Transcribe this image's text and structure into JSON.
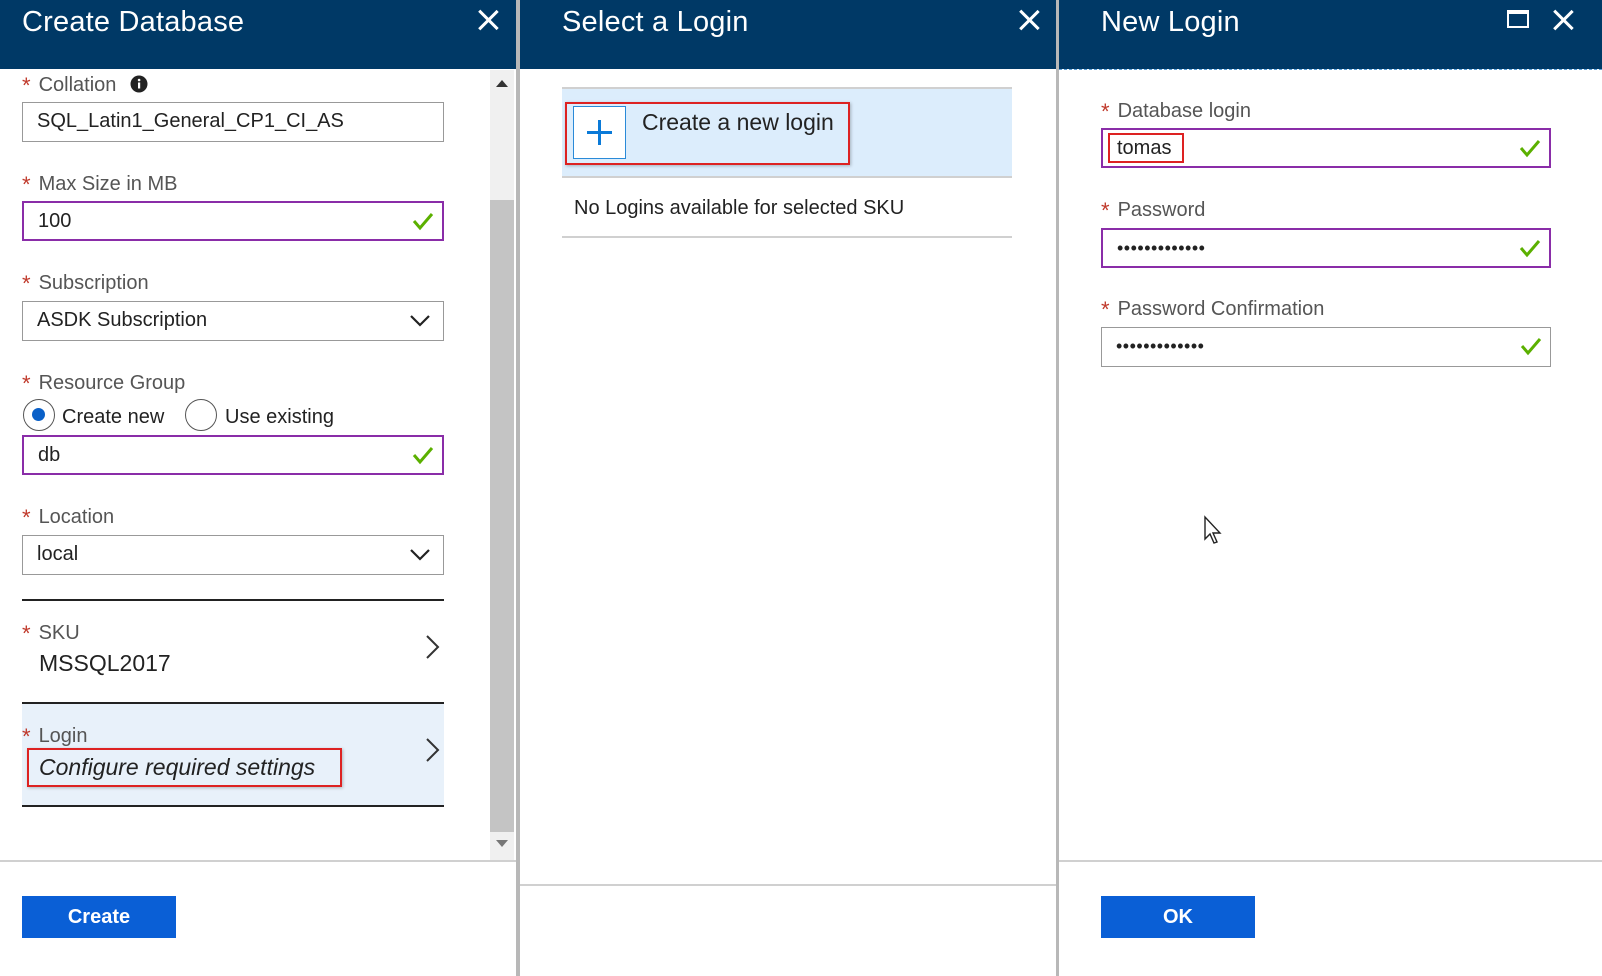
{
  "blade1": {
    "title": "Create Database",
    "collation": {
      "label": "Collation",
      "value": "SQL_Latin1_General_CP1_CI_AS"
    },
    "max_size": {
      "label": "Max Size in MB",
      "value": "100"
    },
    "subscription": {
      "label": "Subscription",
      "value": "ASDK Subscription"
    },
    "resource_group": {
      "label": "Resource Group",
      "option_new": "Create new",
      "option_existing": "Use existing",
      "value": "db"
    },
    "location": {
      "label": "Location",
      "value": "local"
    },
    "sku": {
      "label": "SKU",
      "value": "MSSQL2017"
    },
    "login": {
      "label": "Login",
      "value": "Configure required settings"
    },
    "create_button": "Create"
  },
  "blade2": {
    "title": "Select a Login",
    "create_new": "Create a new login",
    "empty_message": "No Logins available for selected SKU"
  },
  "blade3": {
    "title": "New Login",
    "database_login": {
      "label": "Database login",
      "value": "tomas"
    },
    "password": {
      "label": "Password",
      "value": "•••••••••••••"
    },
    "password_confirm": {
      "label": "Password Confirmation",
      "value": "•••••••••••••"
    },
    "ok_button": "OK"
  },
  "colors": {
    "header": "#003966",
    "accent": "#0a5fd6",
    "valid": "#8a2da8",
    "check": "#5bb000",
    "highlight": "#d22222"
  }
}
